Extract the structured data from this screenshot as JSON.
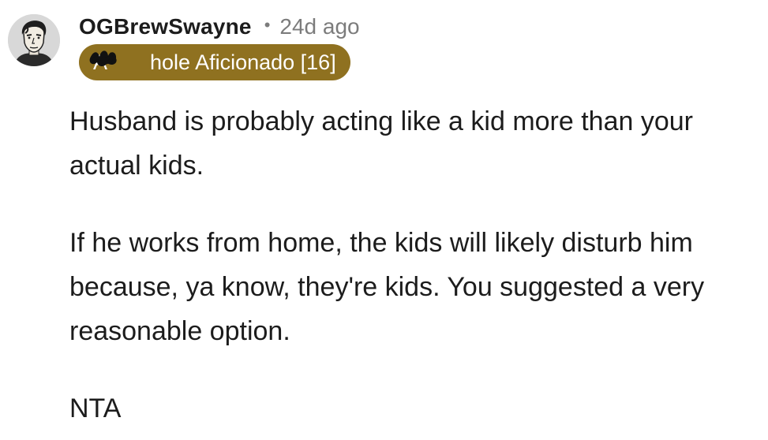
{
  "comment": {
    "username": "OGBrewSwayne",
    "separator": "•",
    "timestamp": "24d ago",
    "flair": "A  hole Aficionado [16]",
    "paragraphs": [
      "Husband is probably acting like a kid more than your actual kids.",
      "If he works from home, the kids will likely disturb him because, ya know, they're kids. You suggested a very reasonable option.",
      "NTA"
    ]
  },
  "colors": {
    "flair_background": "#8f7120",
    "timestamp": "#7c7c7c",
    "text": "#1c1c1c"
  },
  "icons": {
    "avatar": "superhero-portrait-avatar",
    "redaction": "black-scribble-redaction"
  }
}
